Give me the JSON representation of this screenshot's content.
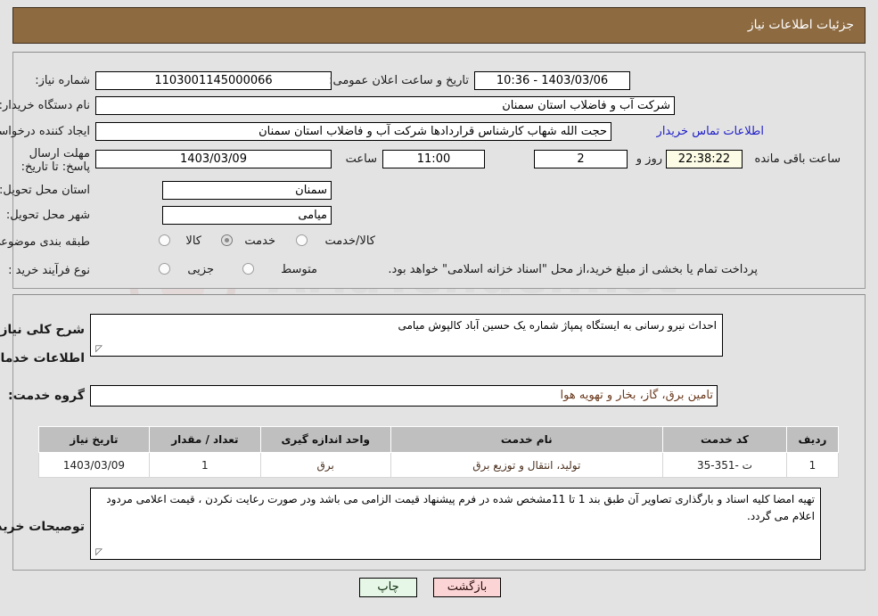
{
  "header": {
    "title": "جزئیات اطلاعات نیاز"
  },
  "form": {
    "need_number_label": "شماره نیاز:",
    "need_number_value": "1103001145000066",
    "public_announce_label": "تاریخ و ساعت اعلان عمومی:",
    "public_announce_value": "1403/03/06 - 10:36",
    "buyer_org_label": "نام دستگاه خریدار:",
    "buyer_org_value": "شرکت آب و فاضلاب استان سمنان",
    "requester_label": "ایجاد کننده درخواست:",
    "requester_value": "حجت الله شهاب کارشناس قراردادها شرکت آب و فاضلاب استان سمنان",
    "buyer_contact_link": "اطلاعات تماس خریدار",
    "deadline_label": "مهلت ارسال پاسخ: تا تاریخ:",
    "deadline_date": "1403/03/09",
    "hour_label": "ساعت",
    "deadline_time": "11:00",
    "days_value": "2",
    "days_unit": "روز و",
    "timer_value": "22:38:22",
    "timer_unit": "ساعت باقی مانده",
    "province_label": "استان محل تحویل:",
    "province_value": "سمنان",
    "city_label": "شهر محل تحویل:",
    "city_value": "میامی",
    "category_label": "طبقه بندی موضوعی:",
    "category_options": [
      "کالا",
      "خدمت",
      "کالا/خدمت"
    ],
    "category_selected": "خدمت",
    "process_label": "نوع فرآیند خرید :",
    "process_options": [
      "جزیی",
      "متوسط"
    ],
    "process_selected": "",
    "payment_note": "پرداخت تمام یا بخشی از مبلغ خرید،از محل \"اسناد خزانه اسلامی\" خواهد بود."
  },
  "details": {
    "need_desc_label": "شرح کلی نیاز:",
    "need_desc_value": "احداث نیرو رسانی به ایستگاه پمپاژ شماره یک حسین آباد کالپوش میامی",
    "services_section_title": "اطلاعات خدمات مورد نیاز",
    "service_group_label": "گروه خدمت:",
    "service_group_value": "تامین برق، گاز، بخار و تهویه هوا",
    "buyer_notes_label": "توصیحات خریدار:",
    "buyer_notes_value": "تهیه امضا کلیه اسناد و بارگذاری تصاویر آن طبق بند 1 تا 11مشخص شده در فرم پیشنهاد قیمت الزامی می باشد ودر صورت رعایت نکردن ، قیمت اعلامی مردود اعلام می گردد."
  },
  "table": {
    "columns": [
      "ردیف",
      "کد خدمت",
      "نام خدمت",
      "واحد اندازه گیری",
      "تعداد / مقدار",
      "تاریخ نیاز"
    ],
    "rows": [
      {
        "row_no": "1",
        "service_code": "ت -351-35",
        "service_name": "تولید، انتقال و توزیع برق",
        "unit": "برق",
        "quantity": "1",
        "need_date": "1403/03/09"
      }
    ]
  },
  "buttons": {
    "print": "چاپ",
    "back": "بازگشت"
  },
  "colors": {
    "header_bg": "#8d6a40",
    "page_bg": "#e3e3e3",
    "link": "#2020c8",
    "timer_bg": "#fbfbe6",
    "btn_print_bg": "#e7f7e7",
    "btn_back_bg": "#fbd5d5",
    "table_header_bg": "#bfbfbf"
  }
}
